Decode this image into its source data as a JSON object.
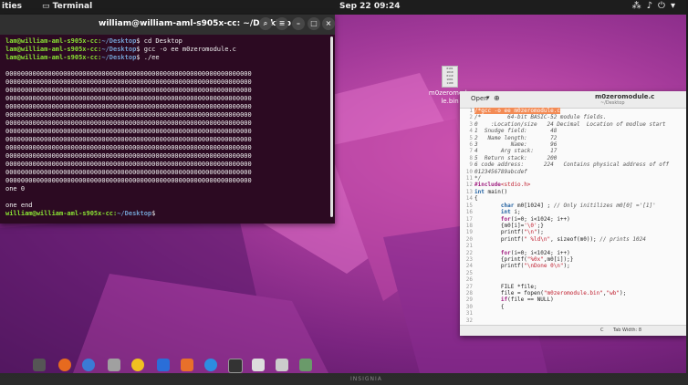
{
  "topbar": {
    "activities": "ities",
    "app_name": "Terminal",
    "clock": "Sep 22  09:24",
    "tray_icons": [
      "network-icon",
      "volume-icon",
      "power-icon",
      "menu-icon"
    ]
  },
  "terminal": {
    "title": "william@william-aml-s905x-cc: ~/Desktop",
    "prompt": "lam@william-aml-s905x-cc",
    "prompt2": "william@william-aml-s905x-cc",
    "path": "~/Desktop",
    "commands": [
      "cd Desktop",
      "gcc -o ee m0zeromodule.c",
      "./ee"
    ],
    "output_lines": [
      "",
      "0000000000000000000000000000000000000000000000000000000000000000",
      "0000000000000000000000000000000000000000000000000000000000000000",
      "0000000000000000000000000000000000000000000000000000000000000000",
      "0000000000000000000000000000000000000000000000000000000000000000",
      "0000000000000000000000000000000000000000000000000000000000000000",
      "0000000000000000000000000000000000000000000000000000000000000000",
      "0000000000000000000000000000000000000000000000000000000000000000",
      "0000000000000000000000000000000000000000000000000000000000000000",
      "0000000000000000000000000000000000000000000000000000000000000000",
      "0000000000000000000000000000000000000000000000000000000000000000",
      "0000000000000000000000000000000000000000000000000000000000000000",
      "0000000000000000000000000000000000000000000000000000000000000000",
      "0000000000000000000000000000000000000000000000000000000000000000",
      "0000000000000000000000000000000000000000000000000000000000000000",
      "one 0",
      "",
      "one end"
    ]
  },
  "desktop_file": {
    "label": "m0zeromodu\nle.bin"
  },
  "editor": {
    "open_label": "Open",
    "title": "m0zeromodule.c",
    "subtitle": "~/Desktop",
    "gutter": "1\n2\n3\n4\n5\n6\n7\n8\n9\n10\n11\n12\n13\n14\n15\n16\n17\n18\n19\n20\n21\n22\n23\n24\n25\n26\n27\n28\n29\n30\n31\n32",
    "status_c": "C",
    "status_tab": "Tab Width: 8"
  },
  "dock_items": [
    "apps-grid-icon",
    "firefox-icon",
    "thunderbird-icon",
    "files-icon",
    "rhythmbox-icon",
    "writer-icon",
    "software-icon",
    "help-icon",
    "terminal-icon",
    "text-editor-icon",
    "file-icon",
    "trash-icon"
  ],
  "monitor_brand": "INSIGNIA"
}
